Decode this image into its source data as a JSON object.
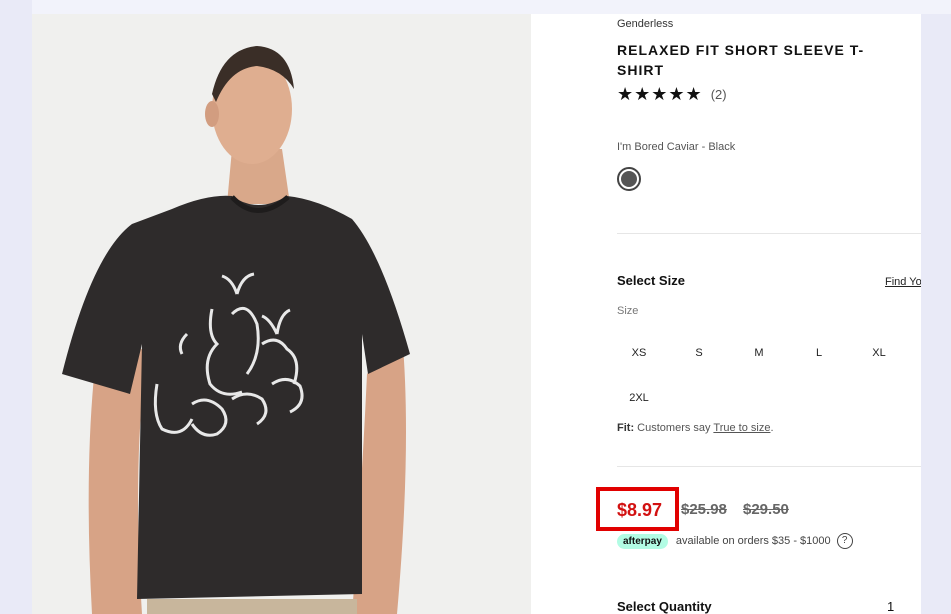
{
  "product": {
    "gender": "Genderless",
    "title": "RELAXED FIT SHORT SLEEVE T-SHIRT",
    "stars": "★★★★★",
    "rating_count": "(2)",
    "color_name": "I'm Bored Caviar - Black",
    "swatch_color": "#555555"
  },
  "size": {
    "heading": "Select Size",
    "find_link": "Find Your Size",
    "label": "Size",
    "options": [
      "XS",
      "S",
      "M",
      "L",
      "XL",
      "2XL"
    ],
    "fit_prefix": "Fit:",
    "fit_text": "Customers say",
    "fit_link": "True to size",
    "fit_suffix": "."
  },
  "price": {
    "current": "$8.97",
    "was_1": "$25.98",
    "was_2": "$29.50",
    "afterpay_label": "afterpay",
    "afterpay_text": "available on orders $35 - $1000",
    "help_icon": "?"
  },
  "quantity": {
    "label": "Select Quantity",
    "value": "1"
  },
  "colors": {
    "sale": "#d21111",
    "highlight_box": "#e10000",
    "afterpay": "#b2fce4"
  }
}
